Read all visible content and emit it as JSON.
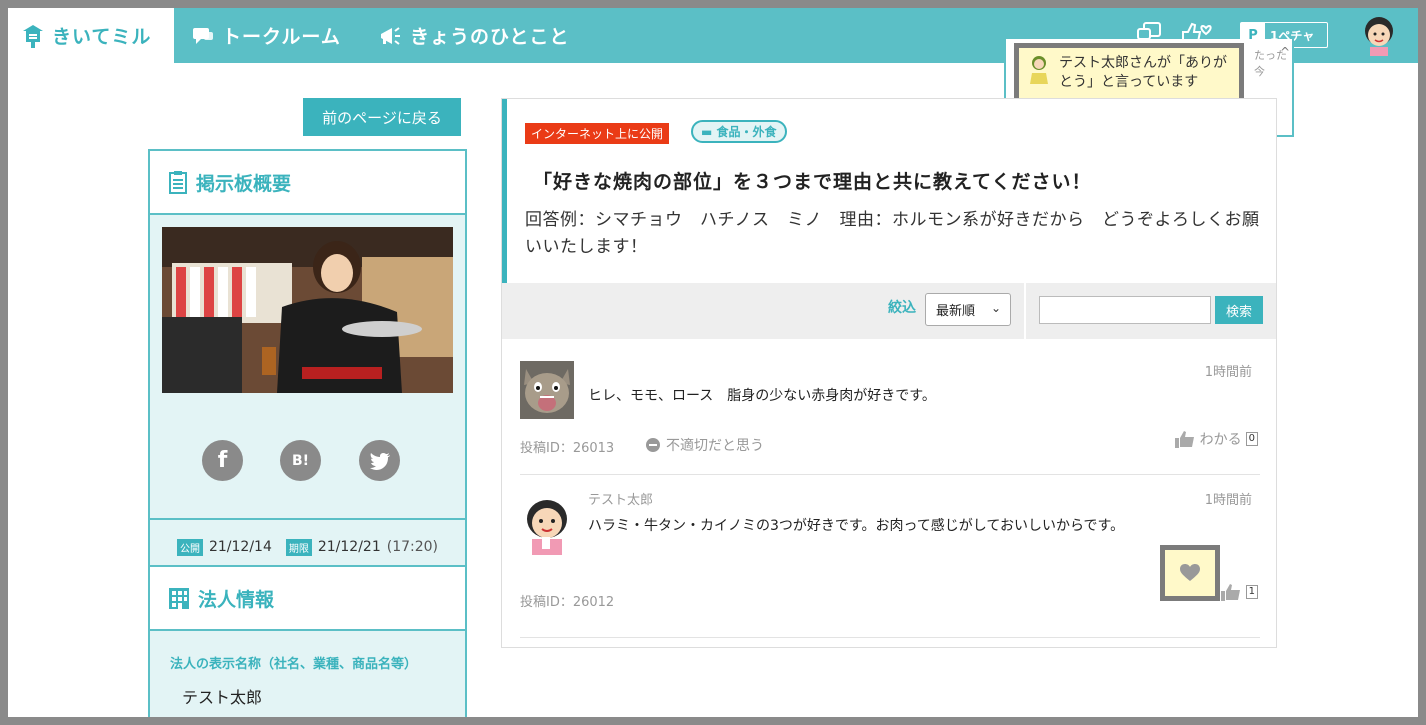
{
  "header": {
    "logo": "きいてミル",
    "nav": [
      {
        "label": "トークルーム"
      },
      {
        "label": "きょうのひとこと"
      }
    ],
    "points_badge_letter": "P",
    "points_badge_value": "1ペチャ"
  },
  "notification": {
    "text": "テスト太郎さんが「ありがとう」と言っています",
    "time": "たった今"
  },
  "back_button": "前のページに戻る",
  "sidebar": {
    "overview_title": "掲示板概要",
    "share_facebook": "f",
    "share_hatena": "B!",
    "public_tag": "公開",
    "public_date": "21/12/14",
    "deadline_tag": "期限",
    "deadline_date": "21/12/21",
    "deadline_time": "(17:20)",
    "corp_title": "法人情報",
    "corp_label": "法人の表示名称（社名、業種、商品名等）",
    "corp_name": "テスト太郎"
  },
  "post": {
    "tag_public": "インターネット上に公開",
    "category": "食品・外食",
    "title": "「好きな焼肉の部位」を３つまで理由と共に教えてください！",
    "description": "回答例：シマチョウ　ハチノス　ミノ　理由：ホルモン系が好きだから　どうぞよろしくお願いいたします！"
  },
  "filter": {
    "label": "絞込",
    "sort_value": "最新順",
    "search_value": "",
    "search_button": "検索"
  },
  "comments": [
    {
      "author": "",
      "time": "1時間前",
      "body": "ヒレ、モモ、ロース　脂身の少ない赤身肉が好きです。",
      "post_id": "投稿ID：26013",
      "report": "不適切だと思う",
      "like_label": "わかる",
      "like_count": "0"
    },
    {
      "author": "テスト太郎",
      "time": "1時間前",
      "body": "ハラミ・牛タン・カイノミの3つが好きです。お肉って感じがしておいしいからです。",
      "post_id": "投稿ID：26012",
      "like_count": "1"
    }
  ],
  "colors": {
    "accent": "#3bb3bd",
    "header": "#5bbfc6",
    "public_tag": "#ea3b16",
    "highlight": "#fff9c9"
  }
}
